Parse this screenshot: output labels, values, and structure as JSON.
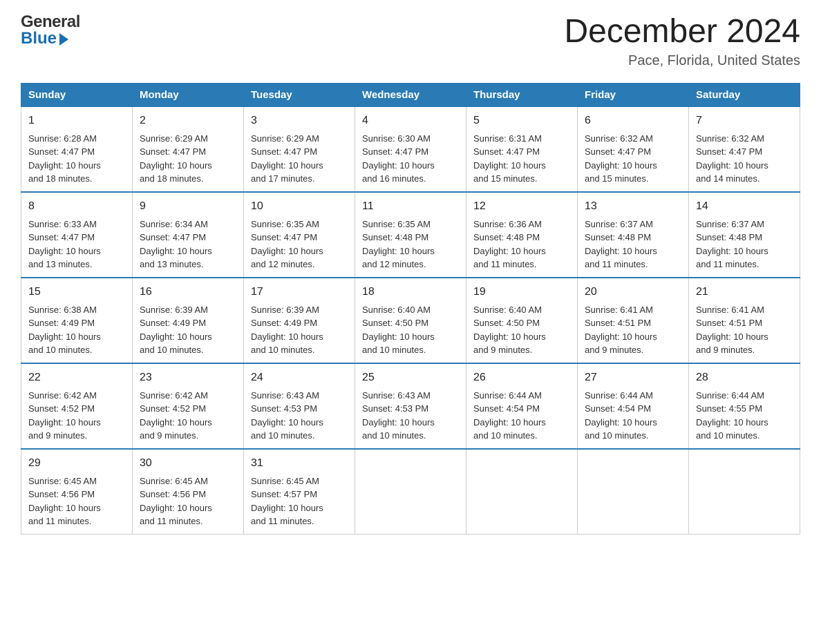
{
  "logo": {
    "general": "General",
    "blue": "Blue",
    "arrow": "arrow-icon"
  },
  "header": {
    "month_title": "December 2024",
    "location": "Pace, Florida, United States"
  },
  "days_of_week": [
    "Sunday",
    "Monday",
    "Tuesday",
    "Wednesday",
    "Thursday",
    "Friday",
    "Saturday"
  ],
  "weeks": [
    [
      {
        "day": "1",
        "sunrise": "6:28 AM",
        "sunset": "4:47 PM",
        "daylight": "10 hours and 18 minutes."
      },
      {
        "day": "2",
        "sunrise": "6:29 AM",
        "sunset": "4:47 PM",
        "daylight": "10 hours and 18 minutes."
      },
      {
        "day": "3",
        "sunrise": "6:29 AM",
        "sunset": "4:47 PM",
        "daylight": "10 hours and 17 minutes."
      },
      {
        "day": "4",
        "sunrise": "6:30 AM",
        "sunset": "4:47 PM",
        "daylight": "10 hours and 16 minutes."
      },
      {
        "day": "5",
        "sunrise": "6:31 AM",
        "sunset": "4:47 PM",
        "daylight": "10 hours and 15 minutes."
      },
      {
        "day": "6",
        "sunrise": "6:32 AM",
        "sunset": "4:47 PM",
        "daylight": "10 hours and 15 minutes."
      },
      {
        "day": "7",
        "sunrise": "6:32 AM",
        "sunset": "4:47 PM",
        "daylight": "10 hours and 14 minutes."
      }
    ],
    [
      {
        "day": "8",
        "sunrise": "6:33 AM",
        "sunset": "4:47 PM",
        "daylight": "10 hours and 13 minutes."
      },
      {
        "day": "9",
        "sunrise": "6:34 AM",
        "sunset": "4:47 PM",
        "daylight": "10 hours and 13 minutes."
      },
      {
        "day": "10",
        "sunrise": "6:35 AM",
        "sunset": "4:47 PM",
        "daylight": "10 hours and 12 minutes."
      },
      {
        "day": "11",
        "sunrise": "6:35 AM",
        "sunset": "4:48 PM",
        "daylight": "10 hours and 12 minutes."
      },
      {
        "day": "12",
        "sunrise": "6:36 AM",
        "sunset": "4:48 PM",
        "daylight": "10 hours and 11 minutes."
      },
      {
        "day": "13",
        "sunrise": "6:37 AM",
        "sunset": "4:48 PM",
        "daylight": "10 hours and 11 minutes."
      },
      {
        "day": "14",
        "sunrise": "6:37 AM",
        "sunset": "4:48 PM",
        "daylight": "10 hours and 11 minutes."
      }
    ],
    [
      {
        "day": "15",
        "sunrise": "6:38 AM",
        "sunset": "4:49 PM",
        "daylight": "10 hours and 10 minutes."
      },
      {
        "day": "16",
        "sunrise": "6:39 AM",
        "sunset": "4:49 PM",
        "daylight": "10 hours and 10 minutes."
      },
      {
        "day": "17",
        "sunrise": "6:39 AM",
        "sunset": "4:49 PM",
        "daylight": "10 hours and 10 minutes."
      },
      {
        "day": "18",
        "sunrise": "6:40 AM",
        "sunset": "4:50 PM",
        "daylight": "10 hours and 10 minutes."
      },
      {
        "day": "19",
        "sunrise": "6:40 AM",
        "sunset": "4:50 PM",
        "daylight": "10 hours and 9 minutes."
      },
      {
        "day": "20",
        "sunrise": "6:41 AM",
        "sunset": "4:51 PM",
        "daylight": "10 hours and 9 minutes."
      },
      {
        "day": "21",
        "sunrise": "6:41 AM",
        "sunset": "4:51 PM",
        "daylight": "10 hours and 9 minutes."
      }
    ],
    [
      {
        "day": "22",
        "sunrise": "6:42 AM",
        "sunset": "4:52 PM",
        "daylight": "10 hours and 9 minutes."
      },
      {
        "day": "23",
        "sunrise": "6:42 AM",
        "sunset": "4:52 PM",
        "daylight": "10 hours and 9 minutes."
      },
      {
        "day": "24",
        "sunrise": "6:43 AM",
        "sunset": "4:53 PM",
        "daylight": "10 hours and 10 minutes."
      },
      {
        "day": "25",
        "sunrise": "6:43 AM",
        "sunset": "4:53 PM",
        "daylight": "10 hours and 10 minutes."
      },
      {
        "day": "26",
        "sunrise": "6:44 AM",
        "sunset": "4:54 PM",
        "daylight": "10 hours and 10 minutes."
      },
      {
        "day": "27",
        "sunrise": "6:44 AM",
        "sunset": "4:54 PM",
        "daylight": "10 hours and 10 minutes."
      },
      {
        "day": "28",
        "sunrise": "6:44 AM",
        "sunset": "4:55 PM",
        "daylight": "10 hours and 10 minutes."
      }
    ],
    [
      {
        "day": "29",
        "sunrise": "6:45 AM",
        "sunset": "4:56 PM",
        "daylight": "10 hours and 11 minutes."
      },
      {
        "day": "30",
        "sunrise": "6:45 AM",
        "sunset": "4:56 PM",
        "daylight": "10 hours and 11 minutes."
      },
      {
        "day": "31",
        "sunrise": "6:45 AM",
        "sunset": "4:57 PM",
        "daylight": "10 hours and 11 minutes."
      },
      null,
      null,
      null,
      null
    ]
  ],
  "labels": {
    "sunrise": "Sunrise:",
    "sunset": "Sunset:",
    "daylight": "Daylight:"
  }
}
